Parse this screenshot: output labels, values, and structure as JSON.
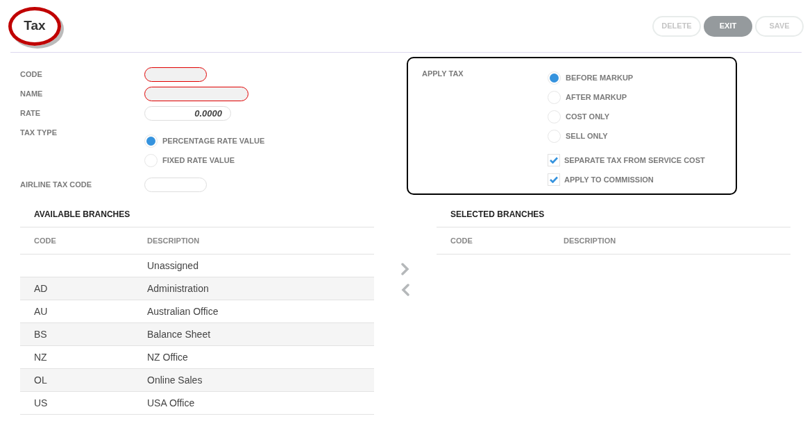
{
  "header": {
    "title": "Tax",
    "buttons": [
      {
        "label": "DELETE",
        "disabled": true,
        "primary": false
      },
      {
        "label": "EXIT",
        "disabled": false,
        "primary": true
      },
      {
        "label": "SAVE",
        "disabled": true,
        "primary": false
      }
    ]
  },
  "form": {
    "fields": [
      {
        "label": "CODE",
        "invalid": true
      },
      {
        "label": "NAME",
        "invalid": true
      },
      {
        "label": "RATE",
        "value": "0.0000",
        "invalid": false
      }
    ],
    "tax_type": {
      "label": "TAX TYPE",
      "options": [
        {
          "label": "PERCENTAGE RATE VALUE",
          "selected": true
        },
        {
          "label": "FIXED RATE VALUE",
          "selected": false
        }
      ]
    },
    "airline_tax_code": {
      "label": "AIRLINE TAX CODE",
      "invalid": false
    }
  },
  "apply_tax": {
    "label": "APPLY TAX",
    "options": [
      {
        "label": "BEFORE MARKUP",
        "selected": true
      },
      {
        "label": "AFTER MARKUP",
        "selected": false
      },
      {
        "label": "COST ONLY",
        "selected": false
      },
      {
        "label": "SELL ONLY",
        "selected": false
      }
    ],
    "checkboxes": [
      {
        "label": "SEPARATE TAX FROM SERVICE COST",
        "checked": true
      },
      {
        "label": "APPLY TO COMMISSION",
        "checked": true
      }
    ]
  },
  "available_branches": {
    "title": "AVAILABLE BRANCHES",
    "columns": [
      "CODE",
      "DESCRIPTION"
    ],
    "rows": [
      [
        "",
        "Unassigned"
      ],
      [
        "AD",
        "Administration"
      ],
      [
        "AU",
        "Australian Office"
      ],
      [
        "BS",
        "Balance Sheet"
      ],
      [
        "NZ",
        "NZ Office"
      ],
      [
        "OL",
        "Online Sales"
      ],
      [
        "US",
        "USA Office"
      ]
    ]
  },
  "selected_branches": {
    "title": "SELECTED BRANCHES",
    "columns": [
      "CODE",
      "DESCRIPTION"
    ]
  }
}
